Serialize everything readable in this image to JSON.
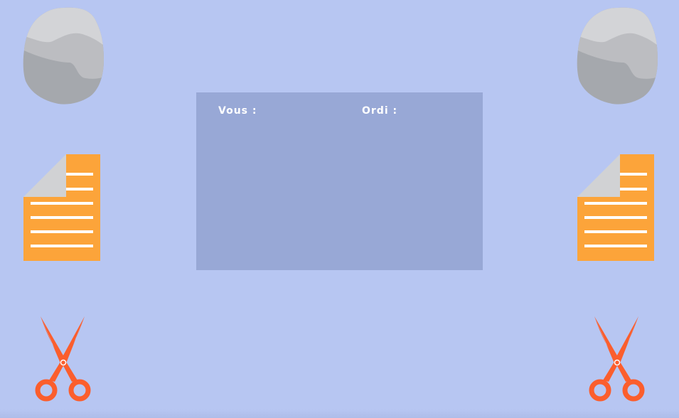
{
  "board": {
    "player_label": "Vous :",
    "computer_label": "Ordi :"
  },
  "choices": {
    "player": [
      "rock-icon",
      "paper-icon",
      "scissors-icon"
    ],
    "computer": [
      "rock-icon",
      "paper-icon",
      "scissors-icon"
    ]
  },
  "colors": {
    "background": "#b7c6f2",
    "board": "#98a8d6",
    "paper": "#fca43a",
    "scissors": "#fb5e2d",
    "rock": "#b5b7bb"
  }
}
